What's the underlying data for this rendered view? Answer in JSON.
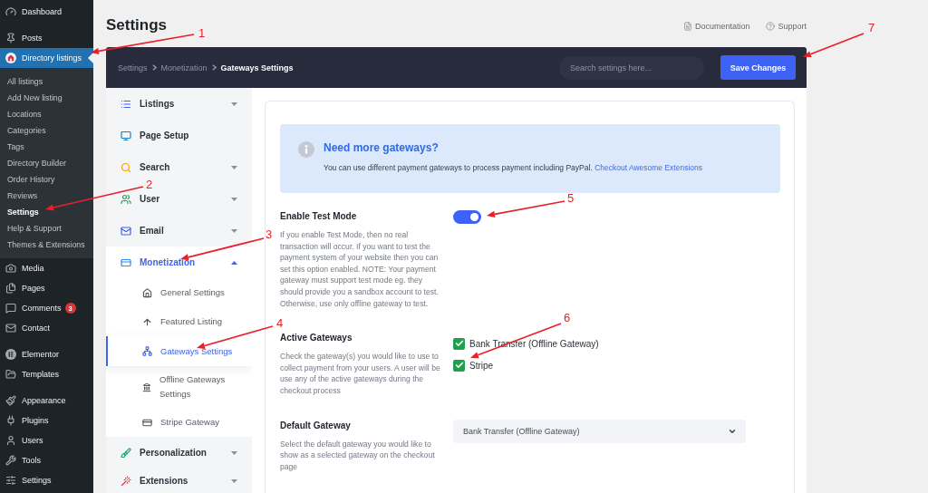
{
  "admin_menu": {
    "groups": [
      {
        "items": [
          {
            "label": "Dashboard",
            "selected": false
          }
        ]
      },
      {
        "items": [
          {
            "label": "Posts",
            "selected": false
          },
          {
            "label": "Directory listings",
            "selected": true,
            "children": [
              {
                "label": "All listings",
                "selected": false
              },
              {
                "label": "Add New listing",
                "selected": false
              },
              {
                "label": "Locations",
                "selected": false
              },
              {
                "label": "Categories",
                "selected": false
              },
              {
                "label": "Tags",
                "selected": false
              },
              {
                "label": "Directory Builder",
                "selected": false
              },
              {
                "label": "Order History",
                "selected": false
              },
              {
                "label": "Reviews",
                "selected": false
              },
              {
                "label": "Settings",
                "selected": true
              },
              {
                "label": "Help & Support",
                "selected": false
              },
              {
                "label": "Themes & Extensions",
                "selected": false
              }
            ]
          },
          {
            "label": "Media",
            "selected": false
          },
          {
            "label": "Pages",
            "selected": false
          },
          {
            "label": "Comments",
            "selected": false,
            "badge": "3"
          },
          {
            "label": "Contact",
            "selected": false
          }
        ]
      },
      {
        "items": [
          {
            "label": "Elementor",
            "selected": false
          },
          {
            "label": "Templates",
            "selected": false
          }
        ]
      },
      {
        "items": [
          {
            "label": "Appearance",
            "selected": false
          },
          {
            "label": "Plugins",
            "selected": false
          },
          {
            "label": "Users",
            "selected": false
          },
          {
            "label": "Tools",
            "selected": false
          },
          {
            "label": "Settings",
            "selected": false
          }
        ]
      }
    ]
  },
  "page_header": {
    "title": "Settings",
    "links": [
      {
        "label": "Documentation"
      },
      {
        "label": "Support"
      }
    ]
  },
  "toolbar": {
    "breadcrumb": [
      {
        "label": "Settings",
        "current": false
      },
      {
        "label": "Monetization",
        "current": false
      },
      {
        "label": "Gateways Settings",
        "current": true
      }
    ],
    "search": {
      "placeholder": "Search settings here..."
    },
    "save_button": {
      "label": "Save Changes"
    }
  },
  "settings_nav": {
    "items": [
      {
        "kind": "group",
        "label": "Listings",
        "expanded": false
      },
      {
        "kind": "page",
        "label": "Page Setup",
        "selected": false
      },
      {
        "kind": "group",
        "label": "Search",
        "expanded": false
      },
      {
        "kind": "group",
        "label": "User",
        "expanded": false
      },
      {
        "kind": "group",
        "label": "Email",
        "expanded": false
      },
      {
        "kind": "group",
        "label": "Monetization",
        "expanded": true,
        "children": [
          {
            "label": "General Settings",
            "selected": false
          },
          {
            "label": "Featured Listing",
            "selected": false
          },
          {
            "label": "Gateways Settings",
            "selected": true
          },
          {
            "label": "Offline Gateways Settings",
            "selected": false
          },
          {
            "label": "Stripe Gateway",
            "selected": false
          }
        ]
      },
      {
        "kind": "group",
        "label": "Personalization",
        "expanded": false
      },
      {
        "kind": "group",
        "label": "Extensions",
        "expanded": false
      }
    ]
  },
  "notice": {
    "title": "Need more gateways?",
    "text": "You can use different payment gateways to process payment including PayPal.",
    "link": "Checkout Awesome Extensions"
  },
  "fields": [
    {
      "kind": "toggle",
      "label": "Enable Test Mode",
      "description": "If you enable Test Mode, then no real transaction will occur. If you want to test the payment system of your website then you can set this option enabled. NOTE: Your payment gateway must support test mode eg. they should provide you a sandbox account to test. Otherwise, use only offline gateway to test.",
      "on": true
    },
    {
      "kind": "checkboxes",
      "label": "Active Gateways",
      "description": "Check the gateway(s) you would like to use to collect payment from your users. A user will be use any of the active gateways during the checkout process",
      "options": [
        {
          "label": "Bank Transfer (Offline Gateway)",
          "checked": true
        },
        {
          "label": "Stripe",
          "checked": true
        }
      ]
    },
    {
      "kind": "select",
      "label": "Default Gateway",
      "description": "Select the default gateway you would like to show as a selected gateway on the checkout page",
      "value": "Bank Transfer (Offline Gateway)"
    }
  ],
  "annotations": [
    {
      "label": "1"
    },
    {
      "label": "2"
    },
    {
      "label": "3"
    },
    {
      "label": "4"
    },
    {
      "label": "5"
    },
    {
      "label": "6"
    },
    {
      "label": "7"
    }
  ]
}
